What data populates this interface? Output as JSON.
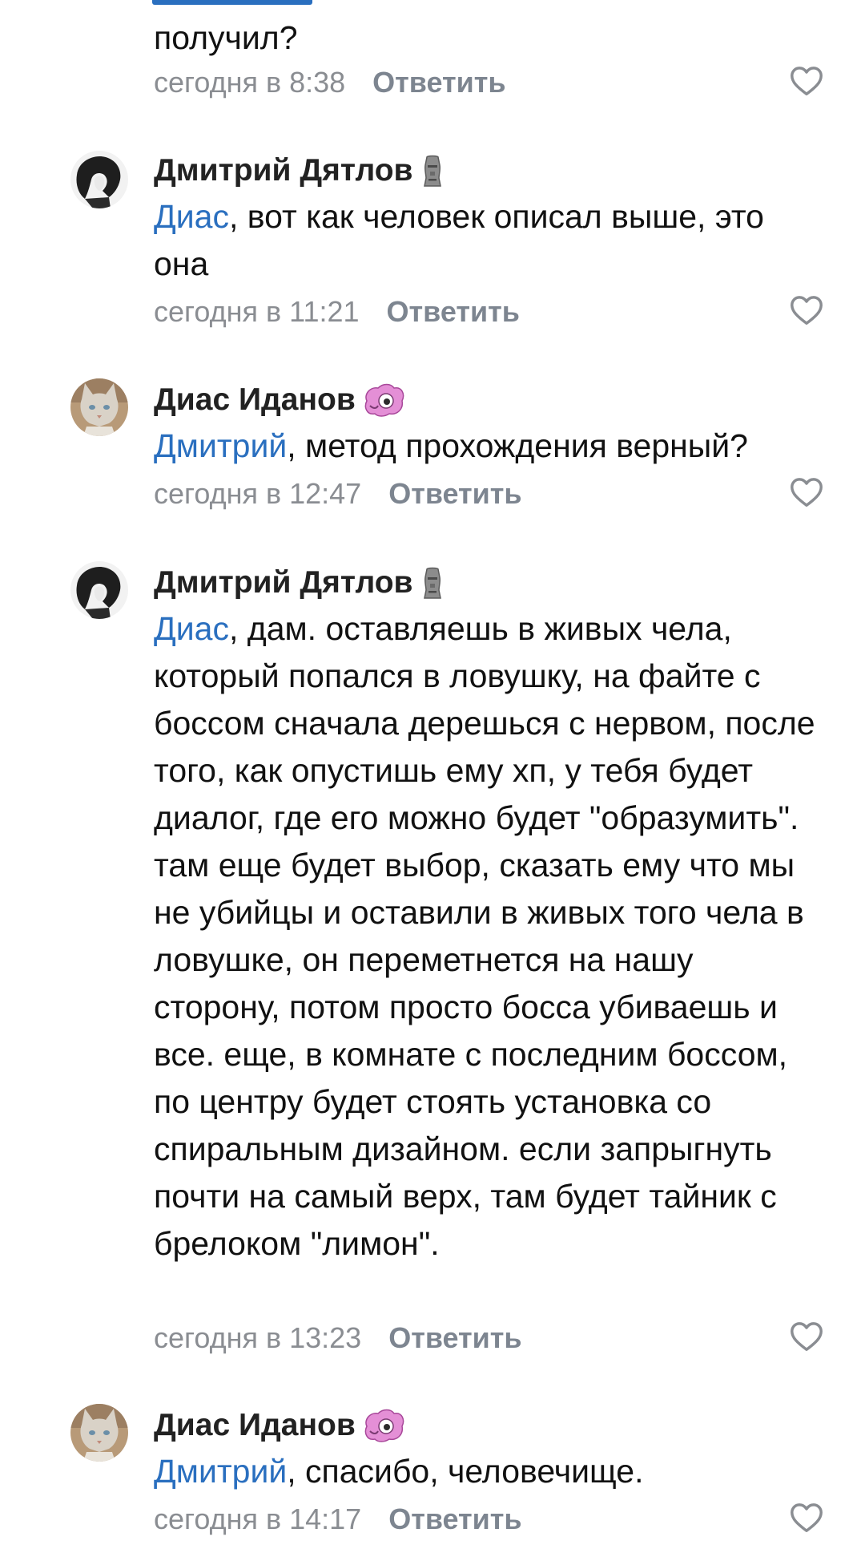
{
  "comments": [
    {
      "author": "",
      "mention": "",
      "text": "получил?",
      "time": "сегодня в 8:38",
      "reply_label": "Ответить"
    },
    {
      "author": "Дмитрий Дятлов",
      "author_emoji_icon": "moai-icon",
      "mention": "Диас",
      "text": ", вот как человек описал выше, это она",
      "time": "сегодня в 11:21",
      "reply_label": "Ответить"
    },
    {
      "author": "Диас Иданов",
      "author_emoji_icon": "pink-monster-icon",
      "mention": "Дмитрий",
      "text": ", метод прохождения верный?",
      "time": "сегодня в 12:47",
      "reply_label": "Ответить"
    },
    {
      "author": "Дмитрий Дятлов",
      "author_emoji_icon": "moai-icon",
      "mention": "Диас",
      "text": ", дам. оставляешь в живых чела, который попался в ловушку, на файте с боссом сначала дерешься с нервом, после того, как опустишь ему хп, у тебя будет диалог, где его можно будет \"образумить\". там еще будет выбор, сказать ему что мы не убийцы и оставили в живых того чела в ловушке, он переметнется на нашу сторону, потом просто босса убиваешь и все. еще, в комнате с последним боссом, по центру будет стоять установка со спиральным дизайном. если запрыгнуть почти на самый верх, там будет тайник с брелоком \"лимон\".",
      "time": "сегодня в 13:23",
      "reply_label": "Ответить"
    },
    {
      "author": "Диас Иданов",
      "author_emoji_icon": "pink-monster-icon",
      "mention": "Дмитрий",
      "text": ", спасибо, человечище.",
      "time": "сегодня в 14:17",
      "reply_label": "Ответить"
    }
  ],
  "colors": {
    "mention": "#2a6fbf",
    "meta": "#8a8d92",
    "reply": "#7d8590",
    "like_outline": "#8a8d92"
  }
}
